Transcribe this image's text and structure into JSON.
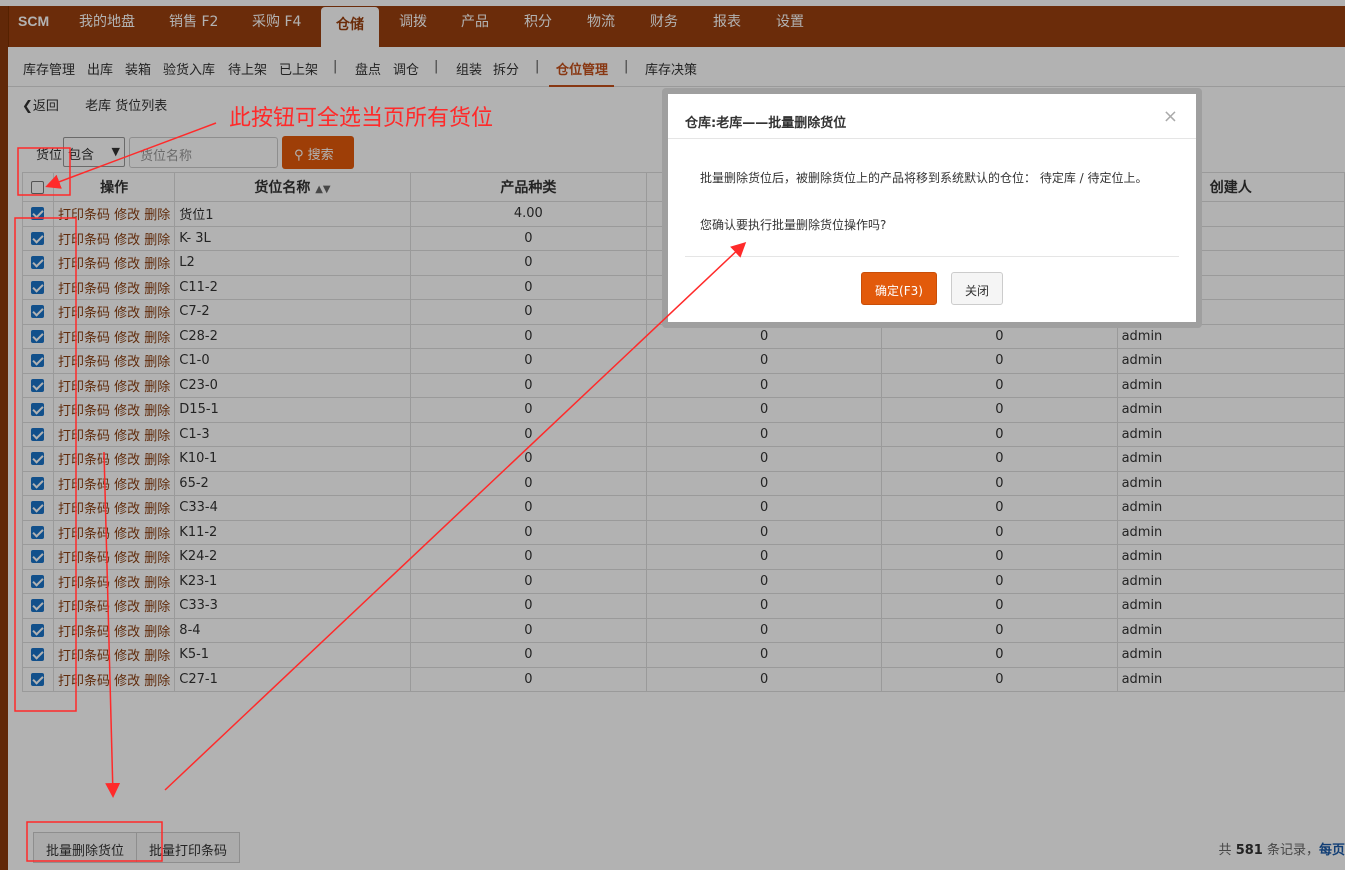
{
  "topnav": {
    "brand": "SCM",
    "items": [
      {
        "label": "我的地盘"
      },
      {
        "label": "销售 F2"
      },
      {
        "label": "采购 F4"
      },
      {
        "label": "仓储"
      },
      {
        "label": "调拨"
      },
      {
        "label": "产品"
      },
      {
        "label": "积分"
      },
      {
        "label": "物流"
      },
      {
        "label": "财务"
      },
      {
        "label": "报表"
      },
      {
        "label": "设置"
      }
    ],
    "active": "仓储"
  },
  "subnav": {
    "items": [
      "库存管理",
      "出库",
      "装箱",
      "验货入库",
      "待上架",
      "已上架",
      "盘点",
      "调仓",
      "组装",
      "拆分",
      "仓位管理",
      "库存决策"
    ],
    "separator": "|",
    "active": "仓位管理"
  },
  "breadcrumb": {
    "back": "返回",
    "title": "老库 货位列表"
  },
  "search": {
    "label": "货位",
    "select_value": "包含",
    "placeholder": "货位名称",
    "button": "搜索"
  },
  "table": {
    "headers": [
      "操作",
      "货位名称",
      "产品种类",
      "创建人"
    ],
    "ops": {
      "print": "打印条码",
      "edit": "修改",
      "delete": "删除"
    },
    "rows": [
      {
        "name": "货位1",
        "kinds": "4.00",
        "c3": "",
        "c4": "",
        "creator": ""
      },
      {
        "name": "K- 3L",
        "kinds": "0",
        "c3": "",
        "c4": "",
        "creator": ""
      },
      {
        "name": "L2",
        "kinds": "0",
        "c3": "",
        "c4": "",
        "creator": ""
      },
      {
        "name": "C11-2",
        "kinds": "0",
        "c3": "",
        "c4": "",
        "creator": ""
      },
      {
        "name": "C7-2",
        "kinds": "0",
        "c3": "",
        "c4": "",
        "creator": ""
      },
      {
        "name": "C28-2",
        "kinds": "0",
        "c3": "0",
        "c4": "0",
        "creator": "admin"
      },
      {
        "name": "C1-0",
        "kinds": "0",
        "c3": "0",
        "c4": "0",
        "creator": "admin"
      },
      {
        "name": "C23-0",
        "kinds": "0",
        "c3": "0",
        "c4": "0",
        "creator": "admin"
      },
      {
        "name": "D15-1",
        "kinds": "0",
        "c3": "0",
        "c4": "0",
        "creator": "admin"
      },
      {
        "name": "C1-3",
        "kinds": "0",
        "c3": "0",
        "c4": "0",
        "creator": "admin"
      },
      {
        "name": "K10-1",
        "kinds": "0",
        "c3": "0",
        "c4": "0",
        "creator": "admin"
      },
      {
        "name": "65-2",
        "kinds": "0",
        "c3": "0",
        "c4": "0",
        "creator": "admin"
      },
      {
        "name": "C33-4",
        "kinds": "0",
        "c3": "0",
        "c4": "0",
        "creator": "admin"
      },
      {
        "name": "K11-2",
        "kinds": "0",
        "c3": "0",
        "c4": "0",
        "creator": "admin"
      },
      {
        "name": "K24-2",
        "kinds": "0",
        "c3": "0",
        "c4": "0",
        "creator": "admin"
      },
      {
        "name": "K23-1",
        "kinds": "0",
        "c3": "0",
        "c4": "0",
        "creator": "admin"
      },
      {
        "name": "C33-3",
        "kinds": "0",
        "c3": "0",
        "c4": "0",
        "creator": "admin"
      },
      {
        "name": "8-4",
        "kinds": "0",
        "c3": "0",
        "c4": "0",
        "creator": "admin"
      },
      {
        "name": "K5-1",
        "kinds": "0",
        "c3": "0",
        "c4": "0",
        "creator": "admin"
      },
      {
        "name": "C27-1",
        "kinds": "0",
        "c3": "0",
        "c4": "0",
        "creator": "admin"
      }
    ]
  },
  "footer": {
    "batch_delete": "批量删除货位",
    "batch_print": "批量打印条码",
    "info_prefix": "共",
    "total": "581",
    "info_suffix": "条记录，",
    "per_page": "每页"
  },
  "modal": {
    "title": "仓库:老库——批量删除货位",
    "close_glyph": "×",
    "message1": "批量删除货位后，被删除货位上的产品将移到系统默认的仓位： 待定库 / 待定位上。",
    "message2": "您确认要执行批量删除货位操作吗?",
    "confirm": "确定(F3)",
    "close": "关闭"
  },
  "annotation": {
    "text": "此按钮可全选当页所有货位",
    "color": "#ff2a2a"
  },
  "colors": {
    "nav_bg": "#9a400f",
    "accent": "#e25a0b",
    "checkbox": "#1a73c8"
  }
}
